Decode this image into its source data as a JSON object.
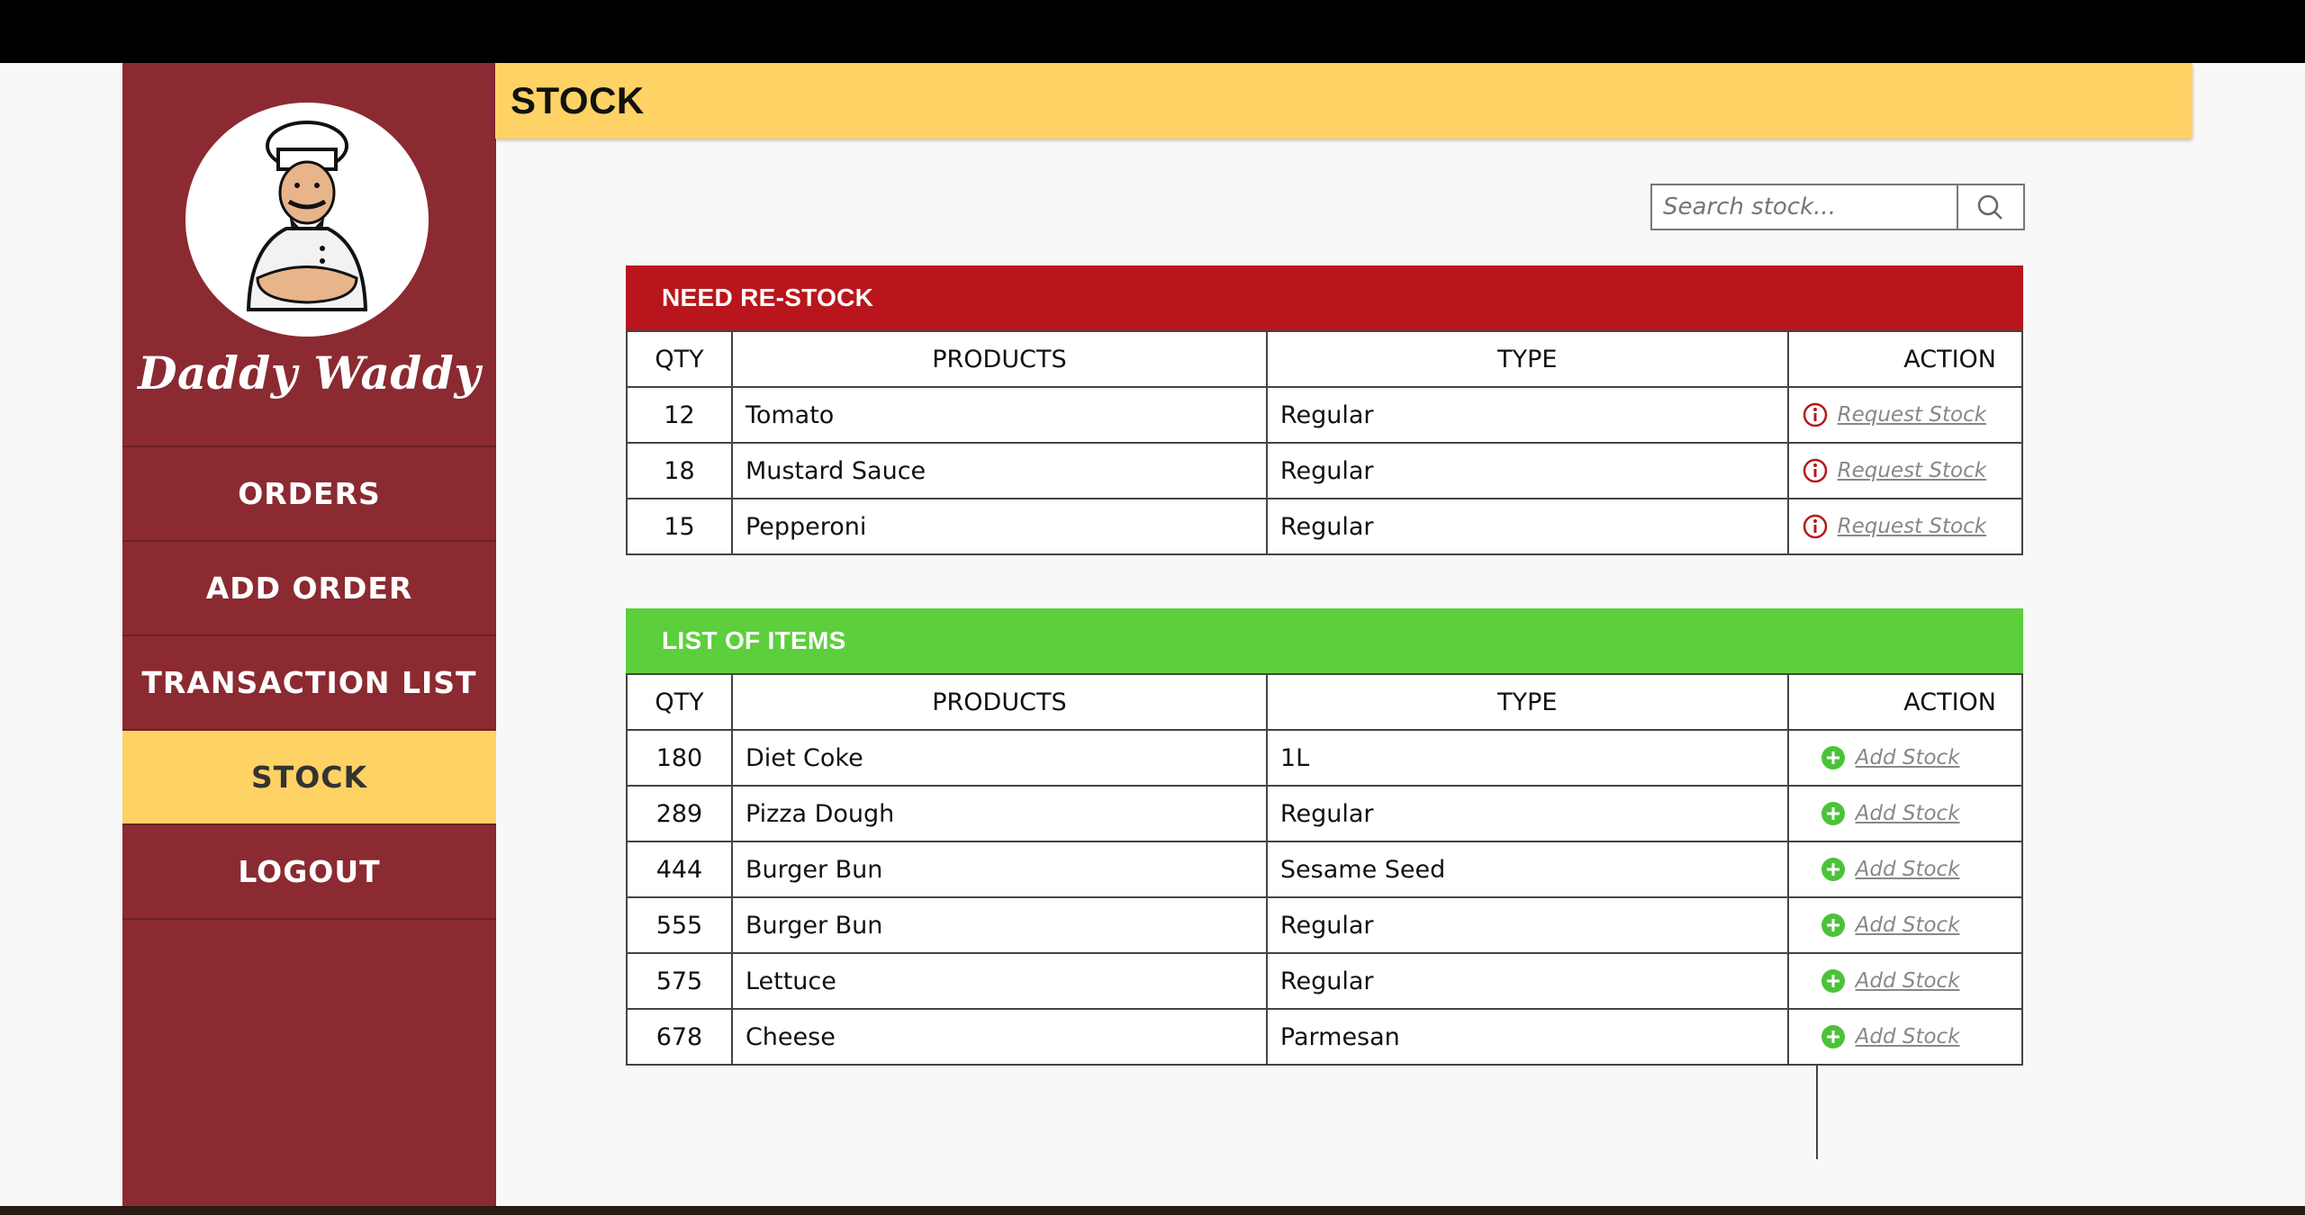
{
  "brand": {
    "name": "Daddy Waddy"
  },
  "nav": {
    "items": [
      {
        "label": "ORDERS",
        "active": false
      },
      {
        "label": "ADD ORDER",
        "active": false
      },
      {
        "label": "TRANSACTION LIST",
        "active": false
      },
      {
        "label": "STOCK",
        "active": true
      },
      {
        "label": "LOGOUT",
        "active": false
      }
    ]
  },
  "header": {
    "title": "STOCK"
  },
  "search": {
    "placeholder": "Search stock...",
    "icon": "search-icon"
  },
  "restock": {
    "title": "NEED RE-STOCK",
    "color": "#b8161c",
    "columns": {
      "qty": "QTY",
      "products": "PRODUCTS",
      "type": "TYPE",
      "action": "ACTION"
    },
    "rows": [
      {
        "qty": "12",
        "product": "Tomato",
        "type": "Regular",
        "action": "Request Stock"
      },
      {
        "qty": "18",
        "product": "Mustard Sauce",
        "type": "Regular",
        "action": "Request Stock"
      },
      {
        "qty": "15",
        "product": "Pepperoni",
        "type": "Regular",
        "action": "Request Stock"
      }
    ]
  },
  "items": {
    "title": "LIST OF ITEMS",
    "color": "#5ccf3c",
    "columns": {
      "qty": "QTY",
      "products": "PRODUCTS",
      "type": "TYPE",
      "action": "ACTION"
    },
    "rows": [
      {
        "qty": "180",
        "product": "Diet Coke",
        "type": "1L",
        "action": "Add Stock"
      },
      {
        "qty": "289",
        "product": "Pizza Dough",
        "type": "Regular",
        "action": "Add Stock"
      },
      {
        "qty": "444",
        "product": "Burger Bun",
        "type": "Sesame Seed",
        "action": "Add Stock"
      },
      {
        "qty": "555",
        "product": "Burger Bun",
        "type": "Regular",
        "action": "Add Stock"
      },
      {
        "qty": "575",
        "product": "Lettuce",
        "type": "Regular",
        "action": "Add Stock"
      },
      {
        "qty": "678",
        "product": "Cheese",
        "type": "Parmesan",
        "action": "Add Stock"
      }
    ]
  },
  "colors": {
    "sidebar": "#8b2a31",
    "accent": "#ffd265"
  }
}
